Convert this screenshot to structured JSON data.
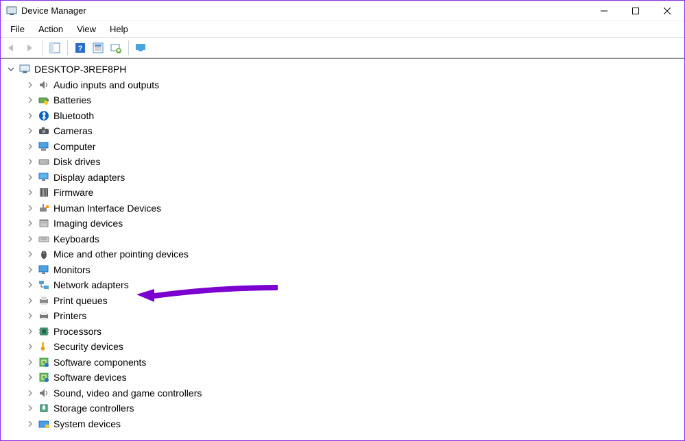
{
  "window": {
    "title": "Device Manager"
  },
  "menu": {
    "file": "File",
    "action": "Action",
    "view": "View",
    "help": "Help"
  },
  "tree": {
    "root": {
      "label": "DESKTOP-3REF8PH",
      "expanded": true
    },
    "items": [
      {
        "label": "Audio inputs and outputs",
        "icon": "speaker"
      },
      {
        "label": "Batteries",
        "icon": "battery"
      },
      {
        "label": "Bluetooth",
        "icon": "bluetooth"
      },
      {
        "label": "Cameras",
        "icon": "camera"
      },
      {
        "label": "Computer",
        "icon": "computer"
      },
      {
        "label": "Disk drives",
        "icon": "disk"
      },
      {
        "label": "Display adapters",
        "icon": "display"
      },
      {
        "label": "Firmware",
        "icon": "firmware"
      },
      {
        "label": "Human Interface Devices",
        "icon": "hid"
      },
      {
        "label": "Imaging devices",
        "icon": "imaging"
      },
      {
        "label": "Keyboards",
        "icon": "keyboard"
      },
      {
        "label": "Mice and other pointing devices",
        "icon": "mouse"
      },
      {
        "label": "Monitors",
        "icon": "monitor"
      },
      {
        "label": "Network adapters",
        "icon": "network"
      },
      {
        "label": "Print queues",
        "icon": "printqueue"
      },
      {
        "label": "Printers",
        "icon": "printer"
      },
      {
        "label": "Processors",
        "icon": "cpu"
      },
      {
        "label": "Security devices",
        "icon": "security"
      },
      {
        "label": "Software components",
        "icon": "software"
      },
      {
        "label": "Software devices",
        "icon": "software"
      },
      {
        "label": "Sound, video and game controllers",
        "icon": "speaker"
      },
      {
        "label": "Storage controllers",
        "icon": "storage"
      },
      {
        "label": "System devices",
        "icon": "system"
      }
    ]
  },
  "annotation": {
    "arrow_target_index": 13,
    "arrow_color": "#7b00d0"
  }
}
